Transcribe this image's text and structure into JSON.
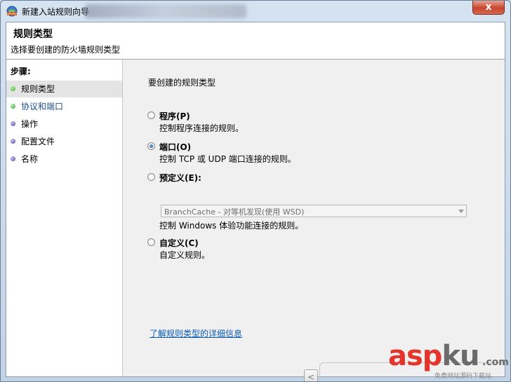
{
  "window": {
    "title": "新建入站规则向导",
    "close_label": "x"
  },
  "header": {
    "title": "规则类型",
    "subtitle": "选择要创建的防火墙规则类型"
  },
  "steps": {
    "title": "步骤:",
    "items": [
      {
        "label": "规则类型"
      },
      {
        "label": "协议和端口"
      },
      {
        "label": "操作"
      },
      {
        "label": "配置文件"
      },
      {
        "label": "名称"
      }
    ]
  },
  "main": {
    "prompt": "要创建的规则类型",
    "options": [
      {
        "title": "程序(P)",
        "desc": "控制程序连接的规则。",
        "checked": false
      },
      {
        "title": "端口(O)",
        "desc": "控制 TCP 或 UDP 端口连接的规则。",
        "checked": true
      },
      {
        "title": "预定义(E):",
        "desc": "控制 Windows 体验功能连接的规则。",
        "checked": false
      },
      {
        "title": "自定义(C)",
        "desc": "自定义规则。",
        "checked": false
      }
    ],
    "predefined_select": "BranchCache - 对等机发现(使用 WSD)",
    "help_link": "了解规则类型的详细信息"
  },
  "footer": {
    "back_label": "<"
  },
  "watermark": {
    "logo_a": "asp",
    "logo_b": "ku",
    "dotcom": ".com",
    "sub": "免费网站源码下载站"
  }
}
